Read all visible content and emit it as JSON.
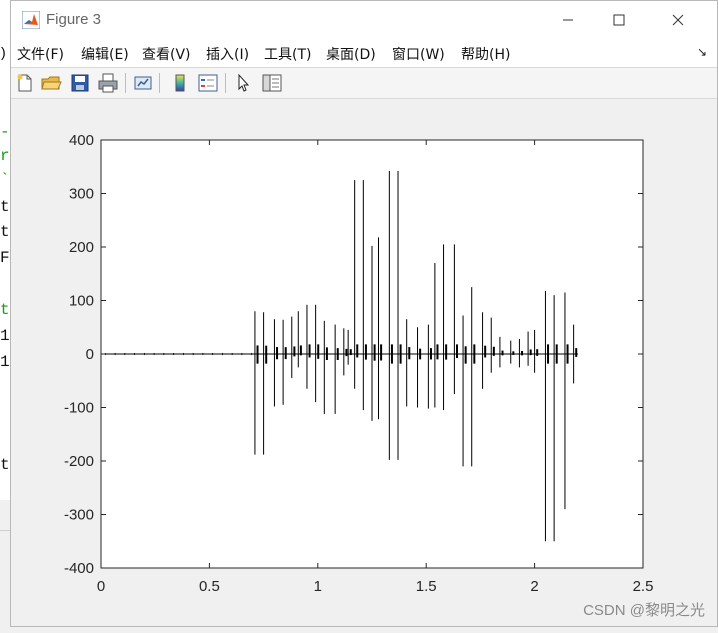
{
  "window": {
    "title": "Figure 3",
    "controls": [
      "minimize",
      "maximize",
      "close"
    ]
  },
  "menu": {
    "items": [
      "文件(F)",
      "编辑(E)",
      "查看(V)",
      "插入(I)",
      "工具(T)",
      "桌面(D)",
      "窗口(W)",
      "帮助(H)"
    ],
    "overflow_icon": "dock-arrow-icon"
  },
  "toolbar": {
    "buttons": [
      "new-figure-icon",
      "open-file-icon",
      "save-icon",
      "print-icon",
      "link-plot-icon",
      "colorbar-icon",
      "legend-icon",
      "edit-plot-arrow-icon",
      "property-inspector-icon"
    ]
  },
  "background_editor": {
    "lines": [
      "-",
      "r",
      "`",
      "t",
      "t",
      "F",
      "t",
      "1",
      "1",
      "t"
    ]
  },
  "chart_data": {
    "type": "line",
    "title": "",
    "xlabel": "",
    "ylabel": "",
    "xlim": [
      0,
      2.5
    ],
    "ylim": [
      -400,
      400
    ],
    "xticks": [
      "0",
      "0.5",
      "1",
      "1.5",
      "2",
      "2.5"
    ],
    "yticks": [
      "400",
      "300",
      "200",
      "100",
      "0",
      "-100",
      "-200",
      "-300",
      "-400"
    ],
    "grid": false,
    "line_color": "#000000",
    "series": [
      {
        "signal_span": [
          0,
          2.2
        ],
        "spikes": [
          {
            "t": 0.71,
            "max": 80,
            "min": -188
          },
          {
            "t": 0.75,
            "max": 78,
            "min": -188
          },
          {
            "t": 0.8,
            "max": 65,
            "min": -98
          },
          {
            "t": 0.84,
            "max": 64,
            "min": -95
          },
          {
            "t": 0.88,
            "max": 70,
            "min": -45
          },
          {
            "t": 0.91,
            "max": 80,
            "min": -25
          },
          {
            "t": 0.95,
            "max": 92,
            "min": -65
          },
          {
            "t": 0.99,
            "max": 92,
            "min": -90
          },
          {
            "t": 1.03,
            "max": 62,
            "min": -112
          },
          {
            "t": 1.08,
            "max": 55,
            "min": -112
          },
          {
            "t": 1.12,
            "max": 48,
            "min": -40
          },
          {
            "t": 1.14,
            "max": 45,
            "min": -20
          },
          {
            "t": 1.17,
            "max": 325,
            "min": -65
          },
          {
            "t": 1.21,
            "max": 325,
            "min": -105
          },
          {
            "t": 1.25,
            "max": 202,
            "min": -125
          },
          {
            "t": 1.28,
            "max": 218,
            "min": -122
          },
          {
            "t": 1.33,
            "max": 342,
            "min": -198
          },
          {
            "t": 1.37,
            "max": 342,
            "min": -198
          },
          {
            "t": 1.41,
            "max": 65,
            "min": -98
          },
          {
            "t": 1.46,
            "max": 50,
            "min": -100
          },
          {
            "t": 1.51,
            "max": 55,
            "min": -102
          },
          {
            "t": 1.54,
            "max": 170,
            "min": -100
          },
          {
            "t": 1.58,
            "max": 205,
            "min": -105
          },
          {
            "t": 1.63,
            "max": 205,
            "min": -75
          },
          {
            "t": 1.67,
            "max": 72,
            "min": -210
          },
          {
            "t": 1.71,
            "max": 125,
            "min": -210
          },
          {
            "t": 1.76,
            "max": 78,
            "min": -65
          },
          {
            "t": 1.8,
            "max": 68,
            "min": -35
          },
          {
            "t": 1.84,
            "max": 32,
            "min": -25
          },
          {
            "t": 1.89,
            "max": 25,
            "min": -18
          },
          {
            "t": 1.93,
            "max": 28,
            "min": -25
          },
          {
            "t": 1.97,
            "max": 42,
            "min": -22
          },
          {
            "t": 2.0,
            "max": 45,
            "min": -35
          },
          {
            "t": 2.05,
            "max": 118,
            "min": -350
          },
          {
            "t": 2.09,
            "max": 110,
            "min": -350
          },
          {
            "t": 2.14,
            "max": 115,
            "min": -290
          },
          {
            "t": 2.18,
            "max": 55,
            "min": -55
          }
        ]
      }
    ]
  },
  "watermark": "CSDN @\u0015黎明之光\u0015"
}
